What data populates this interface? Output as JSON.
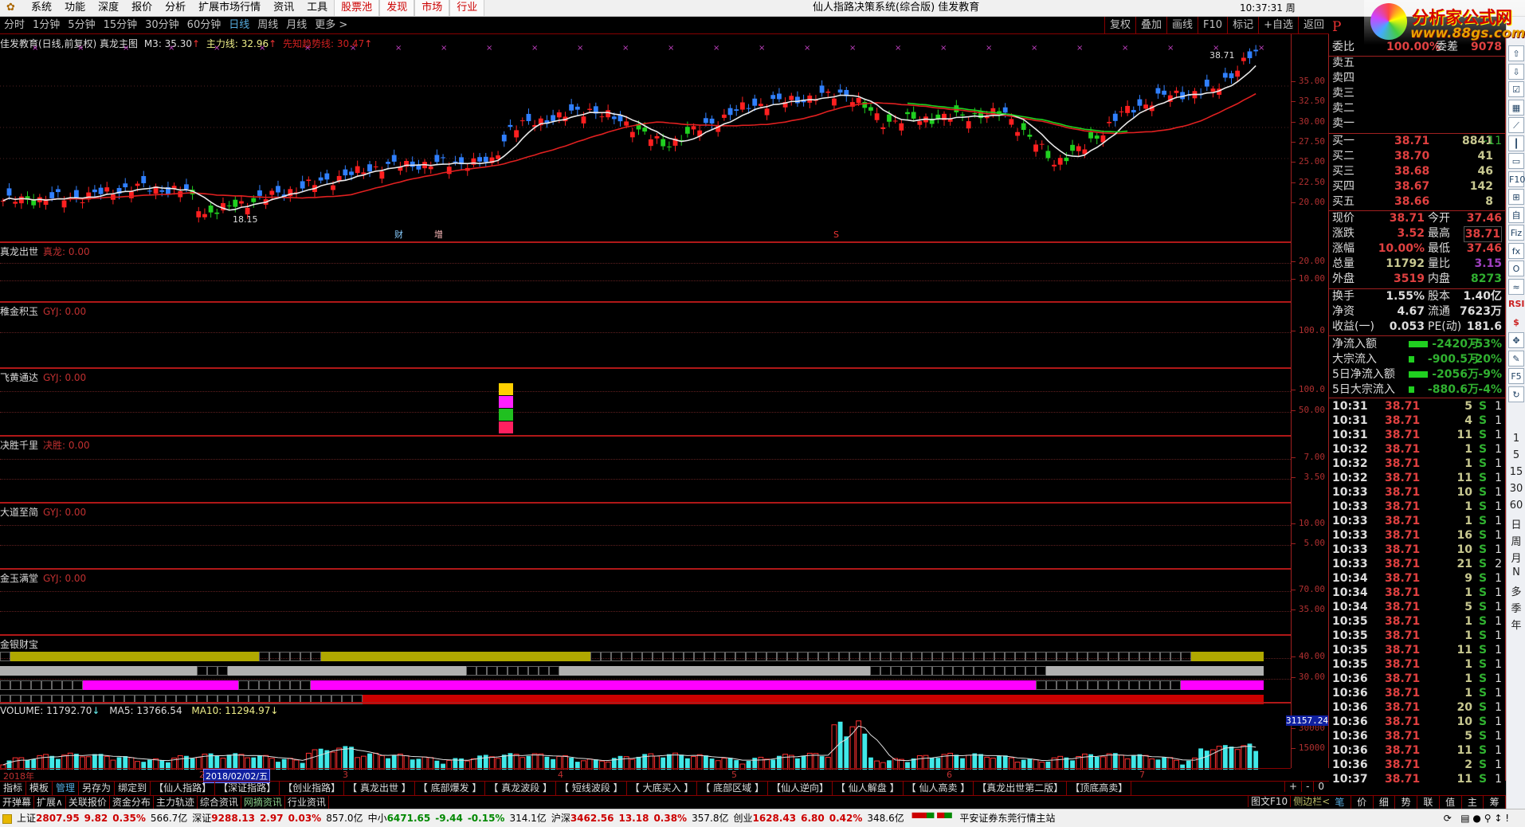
{
  "menu": {
    "items": [
      "系统",
      "功能",
      "深度",
      "报价",
      "分析",
      "扩展市场行情",
      "资讯",
      "工具"
    ],
    "red_items": [
      "股票池",
      "发现",
      "市场",
      "行业"
    ],
    "title": "仙人指路决策系统(综合版)   佳发教育",
    "clock": "10:37:31 周"
  },
  "logo": {
    "line1": "分析家公式网",
    "line2": "www.88gs.com"
  },
  "periods": [
    "分时",
    "1分钟",
    "5分钟",
    "15分钟",
    "30分钟",
    "60分钟",
    "日线",
    "周线",
    "月线",
    "更多 >"
  ],
  "active_period": "日线",
  "right_tools": [
    "复权",
    "叠加",
    "画线",
    "F10",
    "标记",
    "+自选",
    "返回"
  ],
  "p_mark": "P",
  "main_chart": {
    "name": "佳发教育(日线,前复权) 真龙主图",
    "m3": "M3: 35.30",
    "zl": "主力线: 32.96",
    "xz": "先知趋势线: 30.47",
    "high_label": "38.71",
    "low_label": "18.15",
    "markers": [
      "财",
      "增",
      "S"
    ],
    "axis": [
      "35.00",
      "32.50",
      "30.00",
      "27.50",
      "25.00",
      "22.50",
      "20.00"
    ],
    "price_anchors": [
      [
        0,
        20.2
      ],
      [
        12,
        20.6
      ],
      [
        22,
        21.9
      ],
      [
        30,
        21.4
      ],
      [
        33,
        18.6
      ],
      [
        40,
        20.0
      ],
      [
        52,
        22.5
      ],
      [
        62,
        24.5
      ],
      [
        72,
        24.8
      ],
      [
        80,
        25.0
      ],
      [
        83,
        29.2
      ],
      [
        96,
        31.5
      ],
      [
        103,
        29.5
      ],
      [
        108,
        27.0
      ],
      [
        122,
        32.0
      ],
      [
        138,
        33.5
      ],
      [
        144,
        30.0
      ],
      [
        154,
        30.5
      ],
      [
        164,
        31.0
      ],
      [
        172,
        25.0
      ],
      [
        177,
        26.8
      ],
      [
        183,
        31.0
      ],
      [
        190,
        33.2
      ],
      [
        198,
        33.8
      ],
      [
        205,
        38.71
      ]
    ],
    "candle_count": 206
  },
  "panels": [
    {
      "name": "真龙出世",
      "label": "真龙",
      "value": "0.00",
      "axis": [
        "20.00",
        "10.00"
      ]
    },
    {
      "name": "稚金积玉",
      "label": "GYJ",
      "value": "0.00",
      "axis": [
        "100.0"
      ]
    },
    {
      "name": "飞黄通达",
      "label": "GYJ",
      "value": "0.00",
      "axis": [
        "100.0",
        "50.00"
      ]
    },
    {
      "name": "决胜千里",
      "label": "决胜",
      "value": "0.00",
      "axis": [
        "7.00",
        "3.50"
      ]
    },
    {
      "name": "大道至简",
      "label": "GYJ",
      "value": "0.00",
      "axis": [
        "10.00",
        "5.00"
      ]
    },
    {
      "name": "金玉满堂",
      "label": "GYJ",
      "value": "0.00",
      "axis": [
        "70.00",
        "35.00"
      ]
    },
    {
      "name": "金银财宝",
      "label": "",
      "value": "",
      "axis": [
        "40.00",
        "30.00"
      ]
    }
  ],
  "volume": {
    "label": "VOLUME: 11792.70",
    "ma5": "MA5: 13766.54",
    "ma10": "MA10: 11294.97",
    "axis_max": "31157.24",
    "axis": [
      "30000",
      "15000"
    ],
    "max": 31157
  },
  "dates": {
    "year": "2018年",
    "cursor": "2018/02/02/五",
    "months": [
      "2",
      "3",
      "4",
      "5",
      "6",
      "7"
    ]
  },
  "tabs": [
    "指标",
    "模板",
    "管理",
    "另存为",
    "绑定到",
    "【仙人指路】",
    "【深证指路】",
    "【创业指路】",
    "【 真龙出世 】",
    "【 底部爆发 】",
    "【 真龙波段 】",
    "【 短线波段 】",
    "【 大底买入 】",
    "【 底部区域 】",
    "【仙人逆向】",
    "【 仙人解盘 】",
    "【 仙人高卖 】",
    "【真龙出世第二版】",
    "【顶底高卖】"
  ],
  "tabs2": [
    "开弹幕",
    "扩展∧",
    "关联报价",
    "资金分布",
    "主力轨迹",
    "综合资讯",
    "网摘资讯",
    "行业资讯"
  ],
  "zoom_btns": [
    "+",
    "-",
    "0"
  ],
  "tuwen": "图文F10",
  "sidebar_toggle": "侧边栏<",
  "right_tabs": [
    "笔",
    "价",
    "细",
    "势",
    "联",
    "值",
    "主",
    "筹"
  ],
  "quote": {
    "weibi": {
      "l": "委比",
      "v": "100.00%",
      "l2": "委差",
      "v2": "9078"
    },
    "sell": [
      "卖五",
      "卖四",
      "卖三",
      "卖二",
      "卖一"
    ],
    "buy": [
      {
        "l": "买一",
        "p": "38.71",
        "q": "8841",
        "c": "-11"
      },
      {
        "l": "买二",
        "p": "38.70",
        "q": "41",
        "c": ""
      },
      {
        "l": "买三",
        "p": "38.68",
        "q": "46",
        "c": ""
      },
      {
        "l": "买四",
        "p": "38.67",
        "q": "142",
        "c": ""
      },
      {
        "l": "买五",
        "p": "38.66",
        "q": "8",
        "c": ""
      }
    ],
    "stats": [
      {
        "l": "现价",
        "v": "38.71",
        "l2": "今开",
        "v2": "37.46",
        "c": "c-red",
        "c2": "c-red"
      },
      {
        "l": "涨跌",
        "v": "3.52",
        "l2": "最高",
        "v2": "38.71",
        "c": "c-red",
        "c2": "c-red"
      },
      {
        "l": "涨幅",
        "v": "10.00%",
        "l2": "最低",
        "v2": "37.46",
        "c": "c-red",
        "c2": "c-red"
      },
      {
        "l": "总量",
        "v": "11792",
        "l2": "量比",
        "v2": "3.15",
        "c": "c-yel",
        "c2": "c-pur"
      },
      {
        "l": "外盘",
        "v": "3519",
        "l2": "内盘",
        "v2": "8273",
        "c": "c-red",
        "c2": "c-grn"
      }
    ],
    "fin": [
      {
        "l": "换手",
        "v": "1.55%",
        "l2": "股本",
        "v2": "1.40亿"
      },
      {
        "l": "净资",
        "v": "4.67",
        "l2": "流通",
        "v2": "7623万"
      },
      {
        "l": "收益(一)",
        "v": "0.053",
        "l2": "PE(动)",
        "v2": "181.6"
      }
    ],
    "flow": [
      {
        "l": "净流入额",
        "v": "-2420万",
        "p": "-53%",
        "bar": 1
      },
      {
        "l": "大宗流入",
        "v": "-900.5万",
        "p": "-20%",
        "bar": 0.3
      },
      {
        "l": "5日净流入额",
        "v": "-2056万",
        "p": "-9%",
        "bar": 1
      },
      {
        "l": "5日大宗流入",
        "v": "-880.6万",
        "p": "-4%",
        "bar": 0.3
      }
    ],
    "ticks": [
      [
        "10:31",
        "38.71",
        "5",
        "S",
        "1"
      ],
      [
        "10:31",
        "38.71",
        "4",
        "S",
        "1"
      ],
      [
        "10:31",
        "38.71",
        "11",
        "S",
        "1"
      ],
      [
        "10:32",
        "38.71",
        "1",
        "S",
        "1"
      ],
      [
        "10:32",
        "38.71",
        "1",
        "S",
        "1"
      ],
      [
        "10:32",
        "38.71",
        "11",
        "S",
        "1"
      ],
      [
        "10:33",
        "38.71",
        "10",
        "S",
        "1"
      ],
      [
        "10:33",
        "38.71",
        "1",
        "S",
        "1"
      ],
      [
        "10:33",
        "38.71",
        "1",
        "S",
        "1"
      ],
      [
        "10:33",
        "38.71",
        "16",
        "S",
        "1"
      ],
      [
        "10:33",
        "38.71",
        "10",
        "S",
        "1"
      ],
      [
        "10:33",
        "38.71",
        "21",
        "S",
        "2"
      ],
      [
        "10:34",
        "38.71",
        "9",
        "S",
        "1"
      ],
      [
        "10:34",
        "38.71",
        "1",
        "S",
        "1"
      ],
      [
        "10:34",
        "38.71",
        "5",
        "S",
        "1"
      ],
      [
        "10:35",
        "38.71",
        "1",
        "S",
        "1"
      ],
      [
        "10:35",
        "38.71",
        "1",
        "S",
        "1"
      ],
      [
        "10:35",
        "38.71",
        "11",
        "S",
        "1"
      ],
      [
        "10:35",
        "38.71",
        "1",
        "S",
        "1"
      ],
      [
        "10:36",
        "38.71",
        "1",
        "S",
        "1"
      ],
      [
        "10:36",
        "38.71",
        "1",
        "S",
        "1"
      ],
      [
        "10:36",
        "38.71",
        "20",
        "S",
        "1"
      ],
      [
        "10:36",
        "38.71",
        "10",
        "S",
        "1"
      ],
      [
        "10:36",
        "38.71",
        "5",
        "S",
        "1"
      ],
      [
        "10:36",
        "38.71",
        "11",
        "S",
        "1"
      ],
      [
        "10:36",
        "38.71",
        "2",
        "S",
        "1"
      ],
      [
        "10:37",
        "38.71",
        "11",
        "S",
        "1"
      ]
    ]
  },
  "side_icons": [
    "up-arrow-icon",
    "down-arrow-icon",
    "list-check-icon",
    "grid-icon",
    "line-chart-icon",
    "candle-icon",
    "window-icon",
    "F10",
    "tree-icon",
    "自",
    "Fiz",
    "fx",
    "O",
    "wave-icon",
    "RSI",
    "$",
    "move-icon",
    "pencil-icon",
    "F5",
    "refresh-icon"
  ],
  "side_periods": [
    "1",
    "5",
    "15",
    "30",
    "60",
    "日",
    "周",
    "月",
    "N",
    "多",
    "季",
    "年"
  ],
  "status": {
    "items": [
      {
        "n": "上证",
        "v": "2807.95",
        "c": "9.82",
        "p": "0.35%",
        "a": "566.7亿",
        "d": "up"
      },
      {
        "n": "深证",
        "v": "9288.13",
        "c": "2.97",
        "p": "0.03%",
        "a": "857.0亿",
        "d": "up"
      },
      {
        "n": "中小",
        "v": "6471.65",
        "c": "-9.44",
        "p": "-0.15%",
        "a": "314.1亿",
        "d": "dn"
      },
      {
        "n": "沪深",
        "v": "3462.56",
        "c": "13.18",
        "p": "0.38%",
        "a": "357.8亿",
        "d": "up"
      },
      {
        "n": "创业",
        "v": "1628.43",
        "c": "6.80",
        "p": "0.42%",
        "a": "348.6亿",
        "d": "up"
      }
    ],
    "server": "平安证券东莞行情主站"
  }
}
